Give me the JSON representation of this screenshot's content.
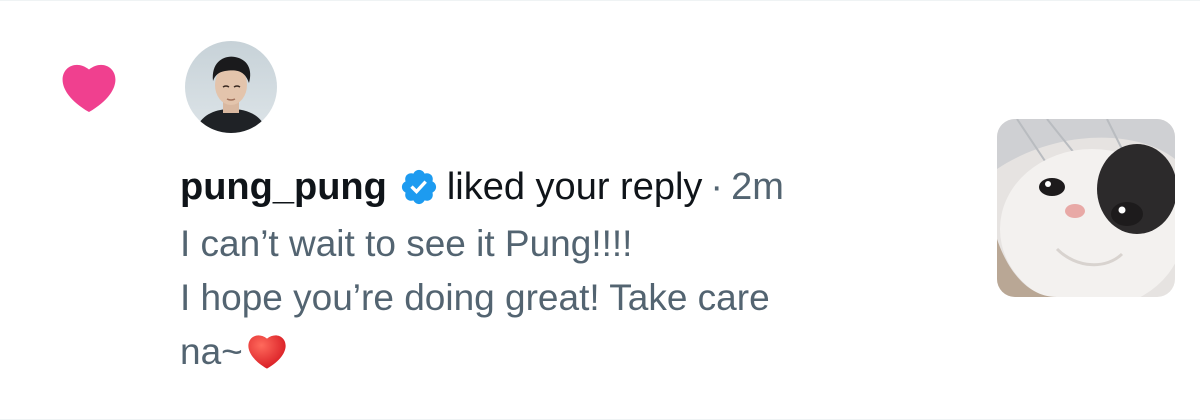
{
  "notification": {
    "type_icon": "heart-icon",
    "avatar_icon": "user-avatar",
    "username": "pung_pung",
    "verified_icon": "verified-badge-icon",
    "action": "liked your reply",
    "separator": "·",
    "time": "2m",
    "reply_lines": [
      "I can’t wait to see it Pung!!!!",
      "I hope you’re doing great! Take care",
      "na~"
    ],
    "reply_emoji_icon": "red-heart-emoji",
    "thumbnail_icon": "cat-photo"
  },
  "colors": {
    "like_pink": "#f91880",
    "verified_blue": "#1d9bf0",
    "text_primary": "#0f1419",
    "text_secondary": "#536471"
  }
}
